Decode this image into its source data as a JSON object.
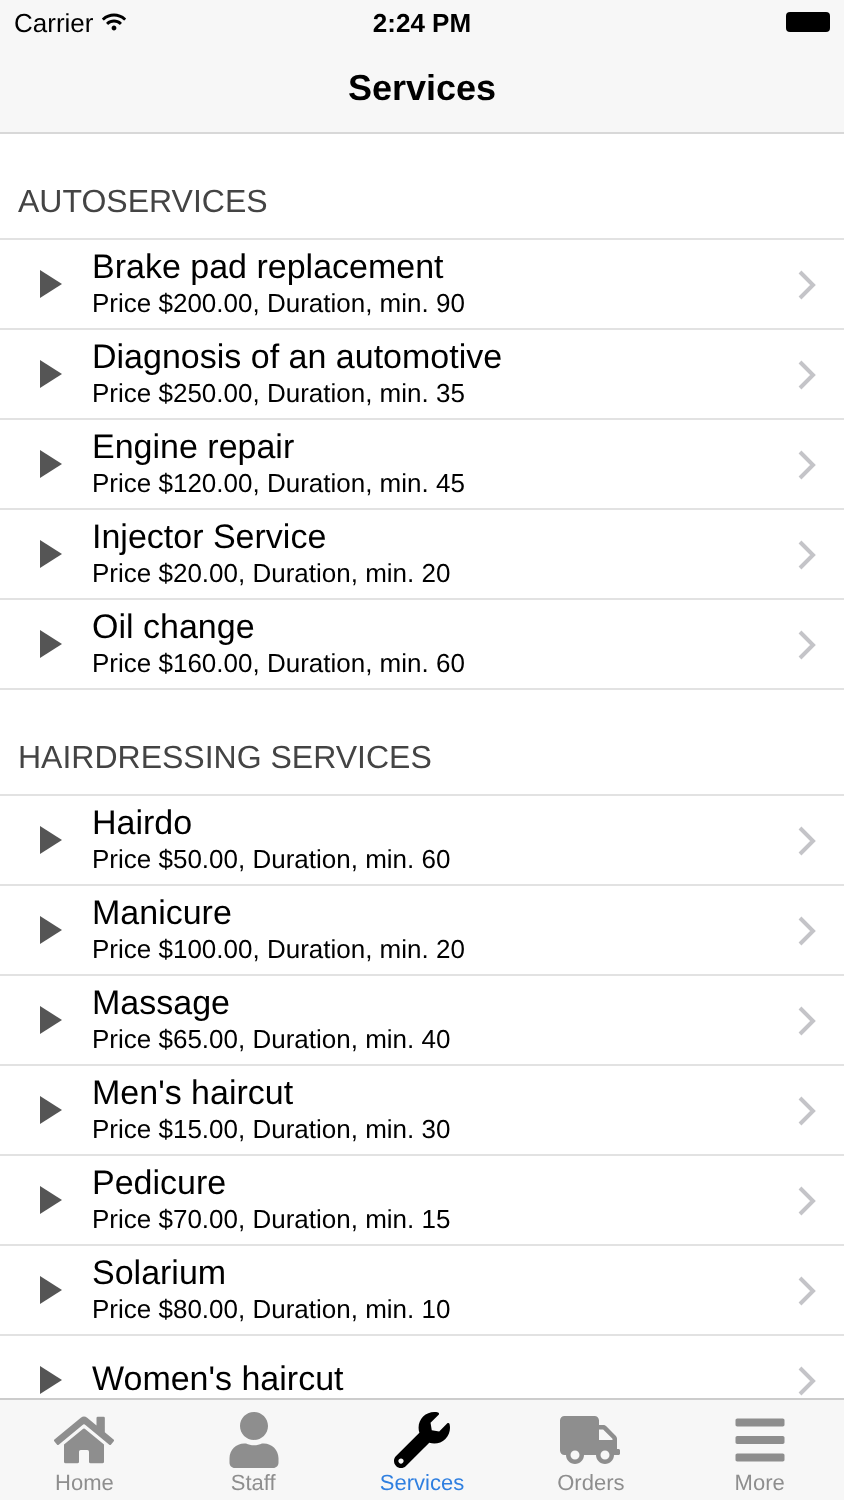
{
  "status_bar": {
    "carrier": "Carrier",
    "time": "2:24 PM"
  },
  "nav": {
    "title": "Services"
  },
  "sections": [
    {
      "header": "AUTOSERVICES",
      "items": [
        {
          "title": "Brake pad replacement",
          "subtitle": "Price $200.00, Duration, min. 90"
        },
        {
          "title": "Diagnosis of an automotive",
          "subtitle": "Price $250.00, Duration, min. 35"
        },
        {
          "title": "Engine repair",
          "subtitle": "Price $120.00, Duration, min. 45"
        },
        {
          "title": "Injector Service",
          "subtitle": "Price $20.00, Duration, min. 20"
        },
        {
          "title": "Oil change",
          "subtitle": "Price $160.00, Duration, min. 60"
        }
      ]
    },
    {
      "header": "HAIRDRESSING SERVICES",
      "items": [
        {
          "title": "Hairdo",
          "subtitle": "Price $50.00, Duration, min. 60"
        },
        {
          "title": "Manicure",
          "subtitle": "Price $100.00, Duration, min. 20"
        },
        {
          "title": "Massage",
          "subtitle": "Price $65.00, Duration, min. 40"
        },
        {
          "title": "Men's haircut",
          "subtitle": "Price $15.00, Duration, min. 30"
        },
        {
          "title": "Pedicure",
          "subtitle": "Price $70.00, Duration, min. 15"
        },
        {
          "title": "Solarium",
          "subtitle": "Price $80.00, Duration, min. 10"
        },
        {
          "title": "Women's haircut"
        }
      ]
    }
  ],
  "tabs": [
    {
      "label": "Home",
      "selected": false
    },
    {
      "label": "Staff",
      "selected": false
    },
    {
      "label": "Services",
      "selected": true
    },
    {
      "label": "Orders",
      "selected": false
    },
    {
      "label": "More",
      "selected": false
    }
  ]
}
